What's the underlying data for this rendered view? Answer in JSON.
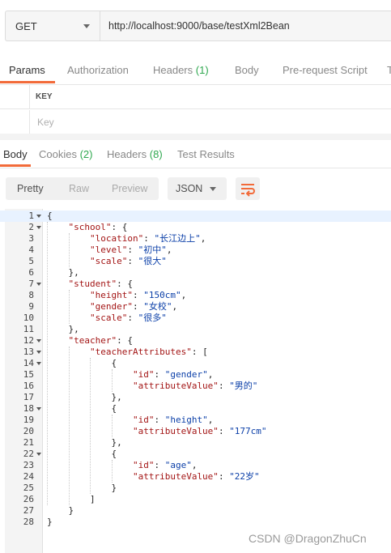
{
  "request": {
    "method": "GET",
    "url": "http://localhost:9000/base/testXml2Bean"
  },
  "request_tabs": [
    {
      "label": "Params",
      "count": ""
    },
    {
      "label": "Authorization",
      "count": ""
    },
    {
      "label": "Headers",
      "count": "(1)"
    },
    {
      "label": "Body",
      "count": ""
    },
    {
      "label": "Pre-request Script",
      "count": ""
    },
    {
      "label": "T",
      "count": ""
    }
  ],
  "params": {
    "header_key": "KEY",
    "key_placeholder": "Key"
  },
  "response_tabs": [
    {
      "label": "Body",
      "count": ""
    },
    {
      "label": "Cookies",
      "count": "(2)"
    },
    {
      "label": "Headers",
      "count": "(8)"
    },
    {
      "label": "Test Results",
      "count": ""
    }
  ],
  "view_modes": [
    "Pretty",
    "Raw",
    "Preview"
  ],
  "format": "JSON",
  "watermark": "CSDN @DragonZhuCn",
  "accent_color": "#f26b3a",
  "code_lines": [
    {
      "n": "1",
      "t": "{"
    },
    {
      "n": "2",
      "t": "    \"school\": {"
    },
    {
      "n": "3",
      "t": "        \"location\": \"长江边上\","
    },
    {
      "n": "4",
      "t": "        \"level\": \"初中\","
    },
    {
      "n": "5",
      "t": "        \"scale\": \"很大\""
    },
    {
      "n": "6",
      "t": "    },"
    },
    {
      "n": "7",
      "t": "    \"student\": {"
    },
    {
      "n": "8",
      "t": "        \"height\": \"150cm\","
    },
    {
      "n": "9",
      "t": "        \"gender\": \"女校\","
    },
    {
      "n": "10",
      "t": "        \"scale\": \"很多\""
    },
    {
      "n": "11",
      "t": "    },"
    },
    {
      "n": "12",
      "t": "    \"teacher\": {"
    },
    {
      "n": "13",
      "t": "        \"teacherAttributes\": ["
    },
    {
      "n": "14",
      "t": "            {"
    },
    {
      "n": "15",
      "t": "                \"id\": \"gender\","
    },
    {
      "n": "16",
      "t": "                \"attributeValue\": \"男的\""
    },
    {
      "n": "17",
      "t": "            },"
    },
    {
      "n": "18",
      "t": "            {"
    },
    {
      "n": "19",
      "t": "                \"id\": \"height\","
    },
    {
      "n": "20",
      "t": "                \"attributeValue\": \"177cm\""
    },
    {
      "n": "21",
      "t": "            },"
    },
    {
      "n": "22",
      "t": "            {"
    },
    {
      "n": "23",
      "t": "                \"id\": \"age\","
    },
    {
      "n": "24",
      "t": "                \"attributeValue\": \"22岁\""
    },
    {
      "n": "25",
      "t": "            }"
    },
    {
      "n": "26",
      "t": "        ]"
    },
    {
      "n": "27",
      "t": "    }"
    },
    {
      "n": "28",
      "t": "}"
    }
  ],
  "foldable_lines": [
    "1",
    "2",
    "7",
    "12",
    "13",
    "14",
    "18",
    "22"
  ]
}
